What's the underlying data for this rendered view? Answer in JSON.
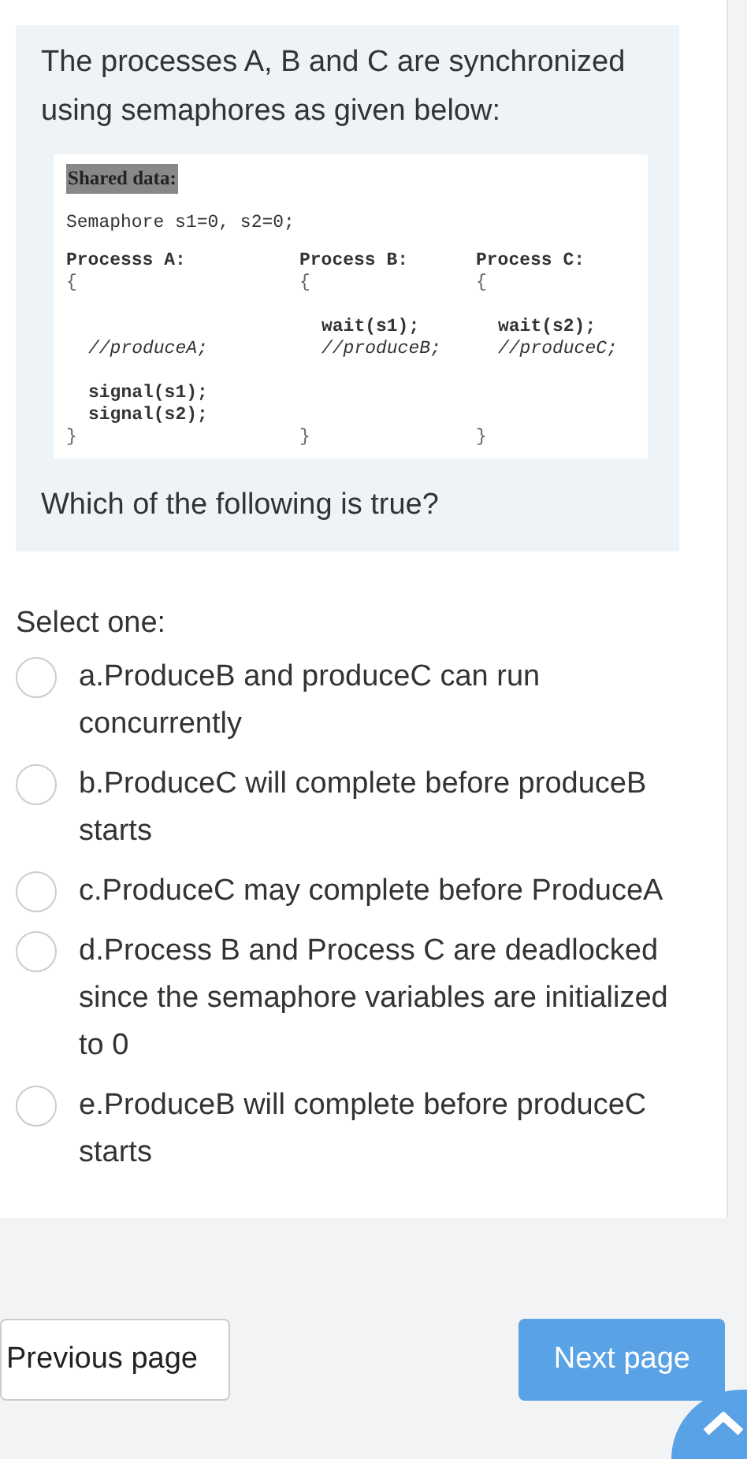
{
  "question": {
    "text": "The processes A, B and C are synchronized using semaphores as given below:",
    "code": {
      "heading": "Shared data:",
      "declaration": "Semaphore s1=0, s2=0;",
      "columns": [
        {
          "lines": [
            {
              "kind": "heading",
              "text": "Processs A:"
            },
            {
              "kind": "brace",
              "text": "{"
            },
            {
              "kind": "spacer"
            },
            {
              "kind": "spacer"
            },
            {
              "kind": "comment",
              "text": "//produceA;"
            },
            {
              "kind": "spacer"
            },
            {
              "kind": "stmt",
              "text": "signal(s1);"
            },
            {
              "kind": "stmt",
              "text": "signal(s2);"
            },
            {
              "kind": "brace",
              "text": "}"
            }
          ]
        },
        {
          "lines": [
            {
              "kind": "heading",
              "text": "Process B:"
            },
            {
              "kind": "brace",
              "text": "{"
            },
            {
              "kind": "spacer"
            },
            {
              "kind": "stmt",
              "text": "wait(s1);"
            },
            {
              "kind": "comment",
              "text": "//produceB;"
            },
            {
              "kind": "spacer"
            },
            {
              "kind": "spacer"
            },
            {
              "kind": "spacer"
            },
            {
              "kind": "brace",
              "text": "}"
            }
          ]
        },
        {
          "lines": [
            {
              "kind": "heading",
              "text": "Process C:"
            },
            {
              "kind": "brace",
              "text": "{"
            },
            {
              "kind": "spacer"
            },
            {
              "kind": "stmt",
              "text": "wait(s2);"
            },
            {
              "kind": "comment",
              "text": "//produceC;"
            },
            {
              "kind": "spacer"
            },
            {
              "kind": "spacer"
            },
            {
              "kind": "spacer"
            },
            {
              "kind": "brace",
              "text": "}"
            }
          ]
        }
      ]
    },
    "prompt": "Which of the following is true?"
  },
  "answer": {
    "label": "Select one:",
    "options": [
      {
        "text": "a.ProduceB and produceC can run concurrently",
        "selected": false
      },
      {
        "text": "b.ProduceC will complete before produceB starts",
        "selected": false
      },
      {
        "text": "c.ProduceC may complete before ProduceA",
        "selected": false
      },
      {
        "text": "d.Process B and Process C are deadlocked since the semaphore variables are initialized to 0",
        "selected": false
      },
      {
        "text": "e.ProduceB will complete before produceC starts",
        "selected": false
      }
    ]
  },
  "navigation": {
    "previous": "Previous page",
    "next": "Next page"
  }
}
